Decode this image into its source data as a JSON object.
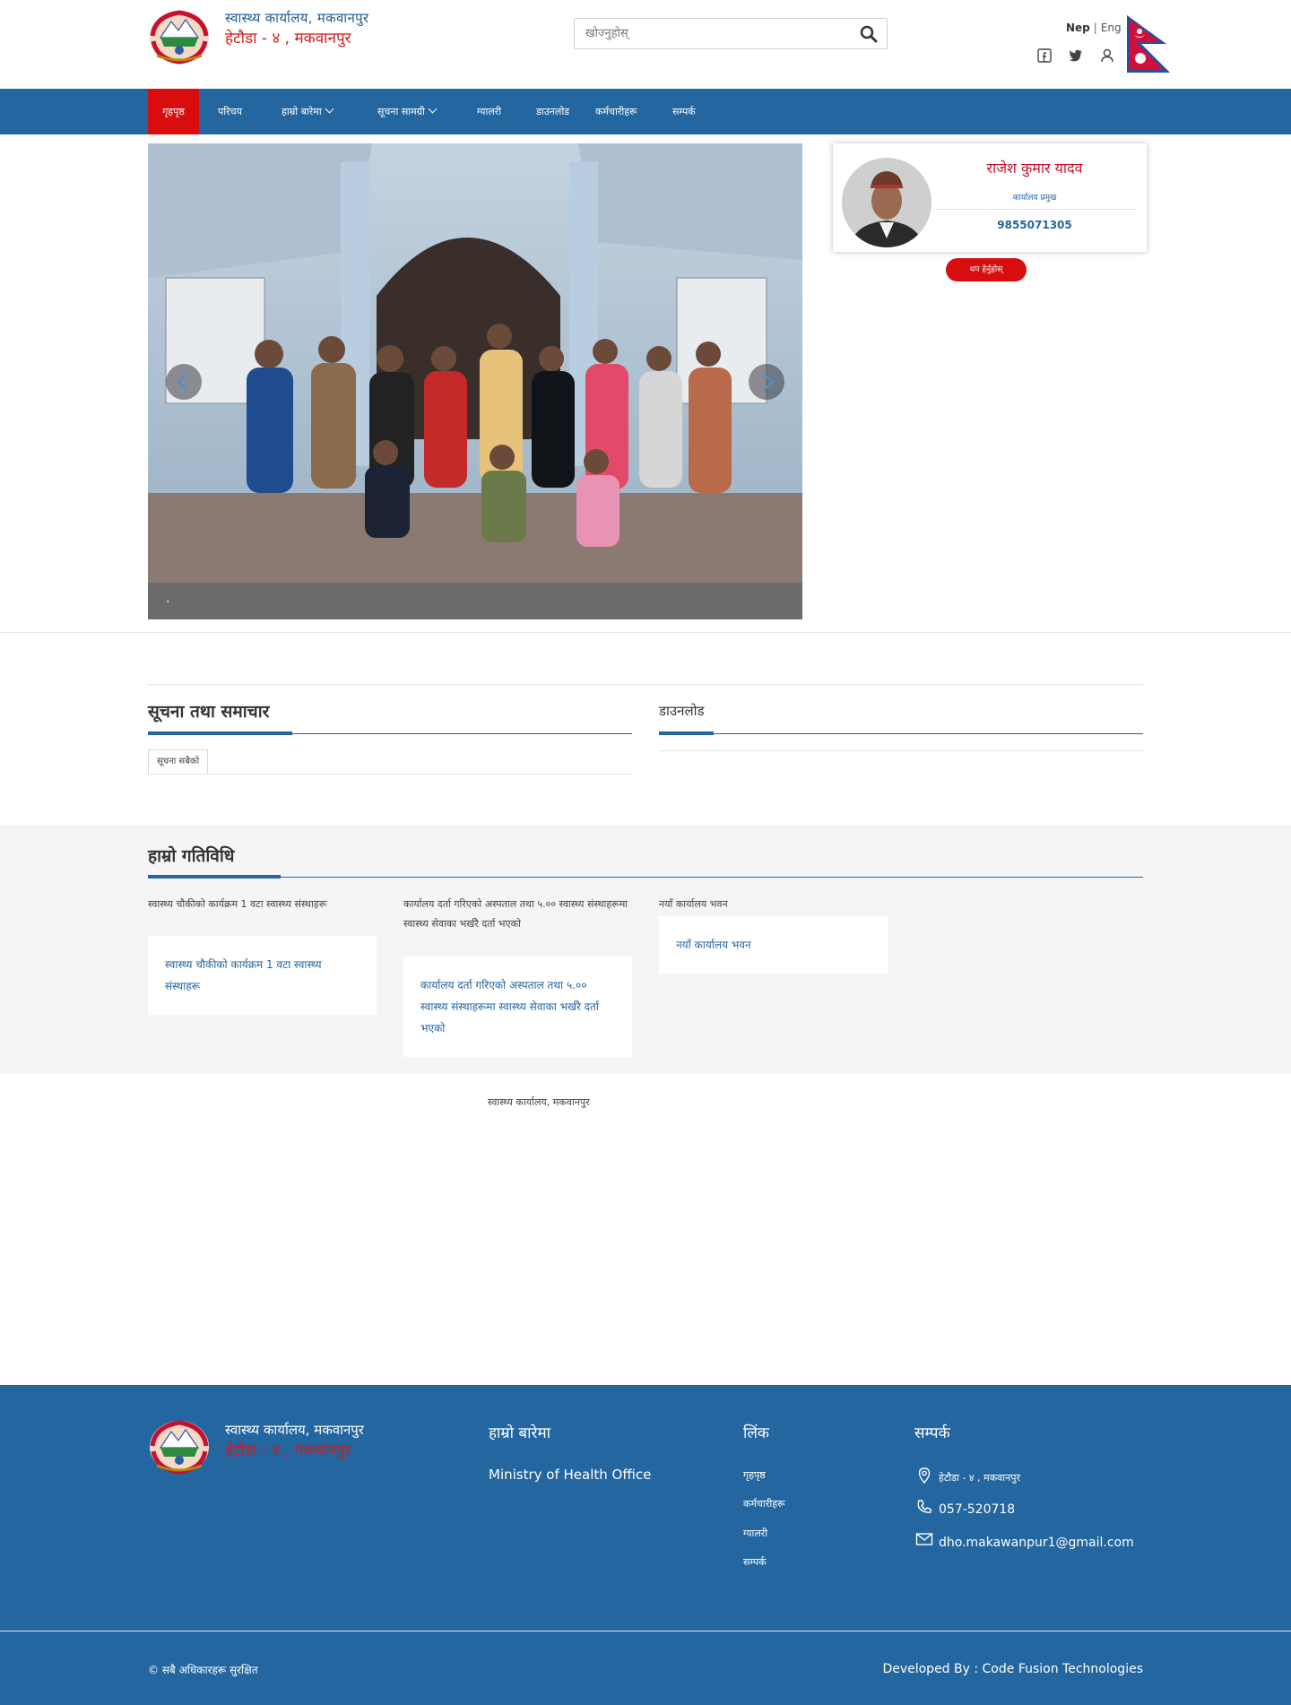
{
  "header": {
    "title": "स्वास्थ्य कार्यालय, मकवानपुर",
    "subtitle": "हेटौडा - ४ , मकवानपुर",
    "search_placeholder": "खोज्नुहोस्",
    "lang_active": "Nep",
    "lang_other": "Eng"
  },
  "nav": {
    "items": [
      {
        "label": "गृहपृष्ठ"
      },
      {
        "label": "परिचय"
      },
      {
        "label": "हाम्रो बारेमा"
      },
      {
        "label": "सूचना सामग्री"
      },
      {
        "label": "ग्यालरी"
      },
      {
        "label": "डाउनलोड"
      },
      {
        "label": "कर्मचारीहरू"
      },
      {
        "label": "सम्पर्क"
      }
    ]
  },
  "slider": {
    "caption": "."
  },
  "chief": {
    "name": "राजेश कुमार यादव",
    "role": "कार्यालय प्रमुख",
    "phone": "9855071305",
    "more_label": "थप हेर्नुहोस्"
  },
  "sections": {
    "notices_title": "सूचना तथा समाचार",
    "notices_tab": "सूचना सबैको",
    "downloads_title": "डाउनलोड"
  },
  "news": {
    "title": "हाम्रो गतिविधि",
    "items": [
      {
        "alt": "स्वास्थ्य चौकीको कार्यक्रम 1 वटा स्वास्थ्य संस्थाहरू",
        "title": "स्वास्थ्य चौकीको कार्यक्रम 1 वटा स्वास्थ्य संस्थाहरू"
      },
      {
        "alt": "कार्यालय दर्ता गरिएको अस्पताल तथा ५.०० स्वास्थ्य संस्थाहरूमा स्वास्थ्य सेवाका भर्खरै दर्ता भएको",
        "title": "कार्यालय दर्ता गरिएको अस्पताल तथा ५.०० स्वास्थ्य संस्थाहरूमा स्वास्थ्य सेवाका भर्खरै दर्ता भएको"
      },
      {
        "alt": "नयाँ कार्यालय भवन",
        "title": "नयाँ कार्यालय भवन"
      }
    ]
  },
  "footer_mid": "स्वास्थ्य कार्यालय, मकवानपुर",
  "footer": {
    "title": "स्वास्थ्य कार्यालय, मकवानपुर",
    "subtitle": "हेटौडा - ४ , मकवानपुर",
    "about_heading": "हाम्रो बारेमा",
    "about_text": "Ministry of Health Office",
    "links_heading": "लिंक",
    "links": [
      {
        "label": "गृहपृष्ठ"
      },
      {
        "label": "कर्मचारीहरू"
      },
      {
        "label": "ग्यालरी"
      },
      {
        "label": "सम्पर्क"
      }
    ],
    "contact_heading": "सम्पर्क",
    "address": "हेटौडा - ४ , मकवानपुर",
    "phone": "057-520718",
    "email": "dho.makawanpur1@gmail.com",
    "copyright": "© सबै अधिकारहरू सुरक्षित",
    "developed_by": "Developed By : Code Fusion Technologies"
  },
  "icons": {
    "search": "search-icon",
    "facebook": "facebook-icon",
    "twitter": "twitter-icon",
    "user": "user-icon",
    "location": "location-pin-icon",
    "phone": "phone-icon",
    "email": "mail-icon"
  },
  "colors": {
    "primary": "#2366a0",
    "accent_red": "#d80e0e",
    "title_red": "#d01c1c",
    "band_gray": "#f5f5f5"
  }
}
